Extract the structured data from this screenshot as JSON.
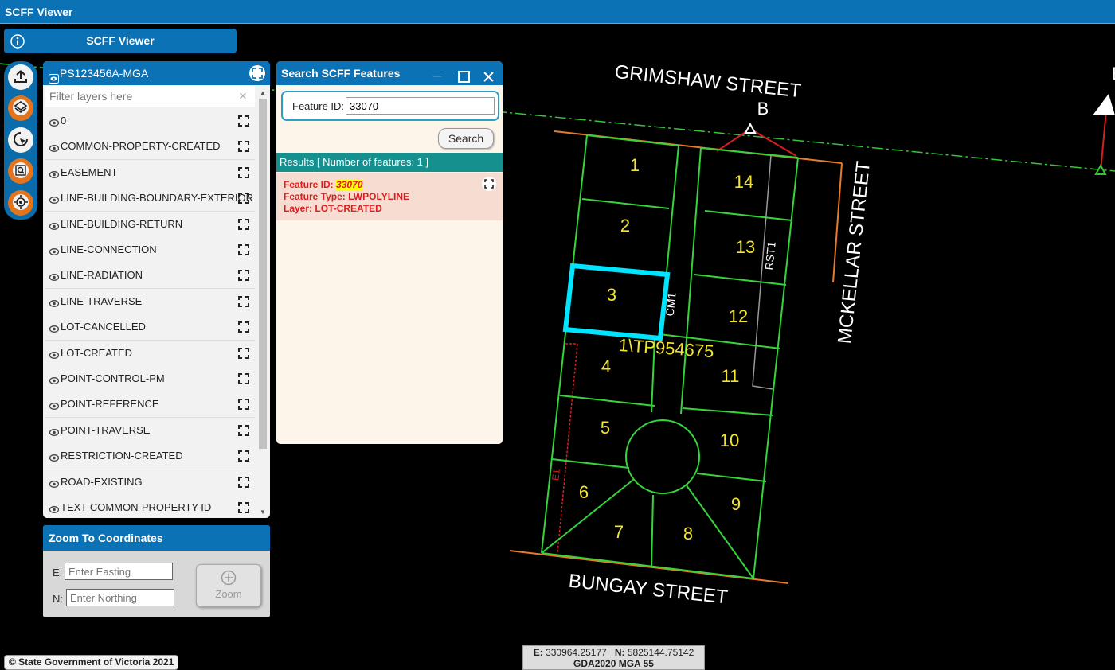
{
  "app": {
    "title": "SCFF Viewer"
  },
  "appbar": {
    "title": "SCFF Viewer"
  },
  "icons": {
    "info": "info-icon",
    "upload": "upload-icon",
    "layers": "layers-icon",
    "select": "select-icon",
    "search": "search-icon",
    "locate": "locate-icon",
    "eye": "eye-icon",
    "zoom": "zoom-to-icon",
    "minimize": "minimize-icon",
    "maximize": "maximize-icon",
    "close": "close-icon",
    "plus": "plus-circle-icon"
  },
  "colors": {
    "brand": "#0b72b5",
    "teal": "#16908f",
    "result_text": "#d91e1e",
    "highlight": "#00e5ff",
    "lot_lines": "#34d43a",
    "lot_numbers": "#f2e531"
  },
  "layers_panel": {
    "title": "PS123456A-MGA",
    "filter_placeholder": "Filter layers here",
    "clear": "×",
    "items": [
      "0",
      "COMMON-PROPERTY-CREATED",
      "EASEMENT",
      "LINE-BUILDING-BOUNDARY-EXTERIOR",
      "LINE-BUILDING-RETURN",
      "LINE-CONNECTION",
      "LINE-RADIATION",
      "LINE-TRAVERSE",
      "LOT-CANCELLED",
      "LOT-CREATED",
      "POINT-CONTROL-PM",
      "POINT-REFERENCE",
      "POINT-TRAVERSE",
      "RESTRICTION-CREATED",
      "ROAD-EXISTING",
      "TEXT-COMMON-PROPERTY-ID"
    ]
  },
  "search_panel": {
    "title": "Search SCFF Features",
    "minimize": "_",
    "feature_id_label": "Feature ID:",
    "feature_id_value": "33070",
    "search_button": "Search",
    "results_label": "Results [ Number of features: 1 ]",
    "result": {
      "id_label": "Feature ID:",
      "id_value": "33070",
      "type_label": "Feature Type:",
      "type_value": "LWPOLYLINE",
      "layer_label": "Layer:",
      "layer_value": "LOT-CREATED"
    }
  },
  "zoom_coords": {
    "title": "Zoom To Coordinates",
    "e_label": "E:",
    "e_placeholder": "Enter Easting",
    "n_label": "N:",
    "n_placeholder": "Enter Northing",
    "button": "Zoom"
  },
  "footer": {
    "copyright": "© State Government of Victoria 2021",
    "e_label": "E:",
    "e_value": "330964.25177",
    "n_label": "N:",
    "n_value": "5825144.75142",
    "crs": "GDA2020 MGA 55"
  },
  "map": {
    "streets": {
      "north": "GRIMSHAW STREET",
      "south": "BUNGAY STREET",
      "east": "MCKELLAR STREET"
    },
    "labels": {
      "b": "B",
      "plan": "1\\TP954675",
      "cm": "CM1",
      "rst": "RST1",
      "e": "E1",
      "edge_partial": "E"
    },
    "lots": [
      "1",
      "2",
      "3",
      "4",
      "5",
      "6",
      "7",
      "8",
      "9",
      "10",
      "11",
      "12",
      "13",
      "14"
    ]
  }
}
